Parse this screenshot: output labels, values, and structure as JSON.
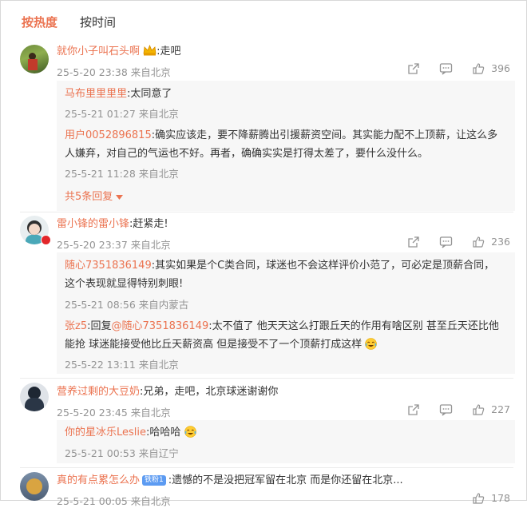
{
  "tabs": {
    "hot": "按热度",
    "time": "按时间"
  },
  "comments": [
    {
      "user": "就你小子叫石头啊",
      "text": ":走吧",
      "meta": "25-5-20 23:38 来自北京",
      "likes": "396",
      "replies": [
        {
          "user": "马布里里里里",
          "text": ":太同意了",
          "meta": "25-5-21 01:27 来自北京"
        },
        {
          "user": "用户0052896815",
          "text1": ":确实应该走，要不降薪腾出引援薪资空间。其实能力配不上顶薪，让这么多",
          "text2": "人嫌弃，对自己的气运也不好。再者，确确实实是打得太差了，要什么没什么。",
          "meta": "25-5-21 11:28 来自北京"
        }
      ],
      "more": "共5条回复"
    },
    {
      "user": "雷小锋的雷小锋",
      "text": ":赶紧走!",
      "meta": "25-5-20 23:37 来自北京",
      "likes": "236",
      "replies": [
        {
          "user": "随心7351836149",
          "text1": ":其实如果是个C类合同，球迷也不会这样评价小范了，可必定是顶薪合同，",
          "text2": "这个表现就显得特别刺眼!",
          "meta": "25-5-21 08:56 来自内蒙古"
        },
        {
          "user": "张z5",
          "reply_word": ":回复",
          "mention": "@随心7351836149",
          "text1": ":太不值了 他天天这么打跟丘天的作用有啥区别  甚至丘天还比他",
          "text2": "能抢 球迷能接受他比丘天薪资高 但是接受不了一个顶薪打成这样",
          "meta": "25-5-22 13:11 来自北京"
        }
      ]
    },
    {
      "user": "营养过剩的大豆奶",
      "text": ":兄弟，走吧，北京球迷谢谢你",
      "meta": "25-5-20 23:45 来自北京",
      "likes": "227",
      "replies": [
        {
          "user": "你的星冰乐Leslie",
          "text": ":哈哈哈",
          "meta": "25-5-21 00:53 来自辽宁"
        }
      ]
    },
    {
      "user": "真的有点累怎么办",
      "badge": "铁粉1",
      "text": ":遗憾的不是没把冠军留在北京 而是你还留在北京...",
      "meta": "25-5-21 00:05 来自北京",
      "likes": "178"
    }
  ],
  "colors": {
    "accent": "#eb7350",
    "meta": "#939393",
    "reply_bg": "#f7f7f7"
  },
  "icons": [
    "share-icon",
    "comment-icon",
    "like-icon",
    "laugh-cry-emoji",
    "crown-emoji"
  ]
}
